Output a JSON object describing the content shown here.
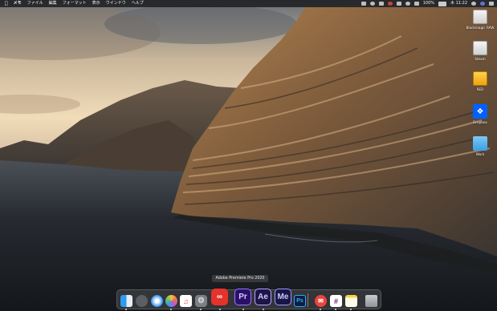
{
  "menubar": {
    "apple_icon": "apple-icon",
    "items": [
      "メモ",
      "ファイル",
      "編集",
      "フォーマット",
      "表示",
      "ウインドウ",
      "ヘルプ"
    ],
    "battery": "100%",
    "clock": "木 11:22"
  },
  "desktop_items": [
    {
      "label": "Blackmagic RAW",
      "icon": "drive-icon"
    },
    {
      "label": "Steam",
      "icon": "drive-icon"
    },
    {
      "label": "RED",
      "icon": "drive-icon"
    },
    {
      "label": "Dropbox",
      "icon": "dropbox-icon"
    },
    {
      "label": "Work",
      "icon": "folder-icon"
    }
  ],
  "dock": {
    "tooltip": "Adobe Premiere Pro 2020",
    "apps": [
      {
        "name": "Finder",
        "icon": "finder-icon"
      },
      {
        "name": "Launchpad",
        "icon": "launchpad-icon"
      },
      {
        "name": "Safari",
        "icon": "safari-icon"
      },
      {
        "name": "Photos",
        "icon": "photos-icon"
      },
      {
        "name": "Music",
        "icon": "music-icon"
      },
      {
        "name": "System Preferences",
        "icon": "gear-icon"
      },
      {
        "name": "Creative Cloud",
        "icon": "creative-cloud-icon"
      },
      {
        "name": "Premiere Pro",
        "label": "Pr"
      },
      {
        "name": "After Effects",
        "label": "Ae"
      },
      {
        "name": "Media Encoder",
        "label": "Me"
      },
      {
        "name": "Photoshop",
        "label": "Ps"
      },
      {
        "name": "Mail",
        "icon": "mail-icon"
      },
      {
        "name": "Slack",
        "icon": "slack-icon"
      },
      {
        "name": "Notes",
        "icon": "notes-icon"
      },
      {
        "name": "Trash",
        "icon": "trash-icon"
      }
    ]
  },
  "colors": {
    "premiere": "#2a0f6b",
    "after_effects": "#1d1447",
    "media_encoder": "#1b1547",
    "photoshop": "#0d1f3d",
    "creative_cloud": "#e5322b"
  }
}
